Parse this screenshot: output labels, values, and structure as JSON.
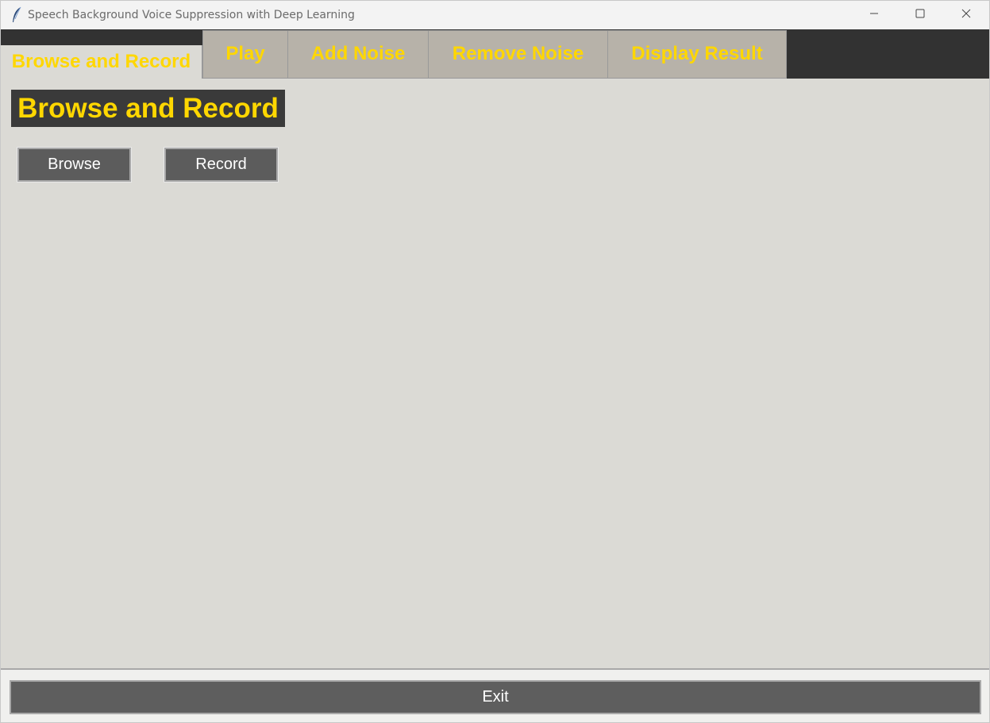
{
  "window": {
    "title": "Speech Background Voice Suppression with Deep Learning",
    "icon": "feather-icon",
    "controls": [
      "minimize-icon",
      "maximize-icon",
      "close-icon"
    ]
  },
  "tabs": [
    {
      "label": "Browse and Record",
      "active": true
    },
    {
      "label": "Play",
      "active": false
    },
    {
      "label": "Add Noise",
      "active": false
    },
    {
      "label": "Remove Noise",
      "active": false
    },
    {
      "label": "Display Result",
      "active": false
    }
  ],
  "main": {
    "heading": "Browse and Record",
    "browse_label": "Browse",
    "record_label": "Record"
  },
  "footer": {
    "exit_label": "Exit"
  },
  "colors": {
    "accent_text": "#ffd700",
    "tab_bar_bg": "#323232",
    "tab_bg": "#b7b2a9",
    "content_bg": "#dbdad5",
    "button_bg": "#5c5c5c"
  }
}
